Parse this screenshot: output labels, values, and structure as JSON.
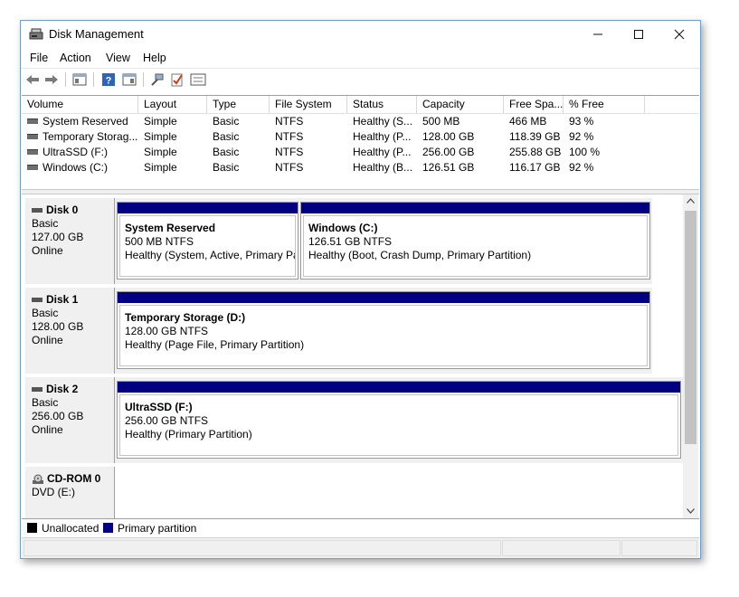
{
  "window": {
    "title": "Disk Management"
  },
  "menu": [
    "File",
    "Action",
    "View",
    "Help"
  ],
  "columns": [
    "Volume",
    "Layout",
    "Type",
    "File System",
    "Status",
    "Capacity",
    "Free Spa...",
    "% Free"
  ],
  "volumes": [
    {
      "volume": "System Reserved",
      "layout": "Simple",
      "type": "Basic",
      "fs": "NTFS",
      "status": "Healthy (S...",
      "capacity": "500 MB",
      "free": "466 MB",
      "pct": "93 %"
    },
    {
      "volume": "Temporary Storag...",
      "layout": "Simple",
      "type": "Basic",
      "fs": "NTFS",
      "status": "Healthy (P...",
      "capacity": "128.00 GB",
      "free": "118.39 GB",
      "pct": "92 %"
    },
    {
      "volume": "UltraSSD (F:)",
      "layout": "Simple",
      "type": "Basic",
      "fs": "NTFS",
      "status": "Healthy (P...",
      "capacity": "256.00 GB",
      "free": "255.88 GB",
      "pct": "100 %"
    },
    {
      "volume": "Windows (C:)",
      "layout": "Simple",
      "type": "Basic",
      "fs": "NTFS",
      "status": "Healthy (B...",
      "capacity": "126.51 GB",
      "free": "116.17 GB",
      "pct": "92 %"
    }
  ],
  "disks": [
    {
      "name": "Disk 0",
      "type": "Basic",
      "size": "127.00 GB",
      "state": "Online",
      "partitions": [
        {
          "name": "System Reserved",
          "size": "500 MB NTFS",
          "status": "Healthy (System, Active, Primary Pa"
        },
        {
          "name": "Windows  (C:)",
          "size": "126.51 GB NTFS",
          "status": "Healthy (Boot, Crash Dump, Primary Partition)"
        }
      ]
    },
    {
      "name": "Disk 1",
      "type": "Basic",
      "size": "128.00 GB",
      "state": "Online",
      "partitions": [
        {
          "name": "Temporary Storage  (D:)",
          "size": "128.00 GB NTFS",
          "status": "Healthy (Page File, Primary Partition)"
        }
      ]
    },
    {
      "name": "Disk 2",
      "type": "Basic",
      "size": "256.00 GB",
      "state": "Online",
      "partitions": [
        {
          "name": "UltraSSD  (F:)",
          "size": "256.00 GB NTFS",
          "status": "Healthy (Primary Partition)"
        }
      ]
    },
    {
      "name": "CD-ROM 0",
      "type": "DVD (E:)"
    }
  ],
  "legend": {
    "unallocated": "Unallocated",
    "primary": "Primary partition"
  },
  "colors": {
    "primary": "#000080",
    "unallocated": "#000000"
  }
}
